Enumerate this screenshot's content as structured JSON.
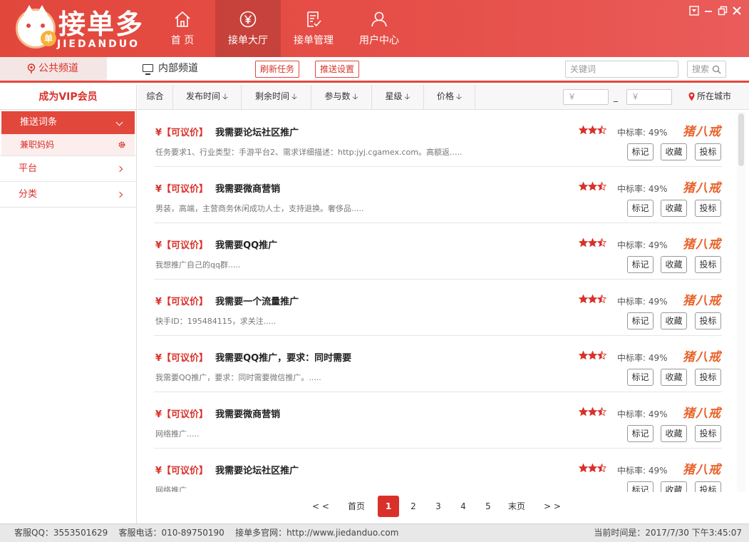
{
  "app": {
    "logo_cn": "接单多",
    "logo_en": "JIEDANDUO",
    "logo_coin": "单"
  },
  "nav": [
    {
      "label": "首 页",
      "icon": "home-icon"
    },
    {
      "label": "接单大厅",
      "icon": "yen-icon",
      "active": true
    },
    {
      "label": "接单管理",
      "icon": "document-icon"
    },
    {
      "label": "用户中心",
      "icon": "user-icon"
    }
  ],
  "channels": {
    "public": "公共频道",
    "private": "内部频道",
    "refresh": "刷新任务",
    "push_settings": "推送设置",
    "search_placeholder": "关键词",
    "search_button": "搜索"
  },
  "sidebar": {
    "vip": "成为VIP会员",
    "section": "推送词条",
    "sub_item": "兼职妈妈",
    "items": [
      "平台",
      "分类"
    ]
  },
  "filters": {
    "items": [
      "综合",
      "发布时间",
      "剩余时间",
      "参与数",
      "星级",
      "价格"
    ],
    "price_min_placeholder": "￥",
    "price_max_placeholder": "￥",
    "dash": "_",
    "city": "所在城市"
  },
  "tasks": [
    {
      "yen": "¥",
      "tag": "【可议价】",
      "title": "我需要论坛社区推广",
      "desc": "任务要求1、行业类型：手游平台2、需求详细描述：http:jyj.cgamex.com。高额返.....",
      "rate": "中标率: 49%",
      "brand": "猪八戒"
    },
    {
      "yen": "¥",
      "tag": "【可议价】",
      "title": "我需要微商营销",
      "desc": "男装，高端，主营商务休闲成功人士，支持退换。奢侈品.....",
      "rate": "中标率: 49%",
      "brand": "猪八戒"
    },
    {
      "yen": "¥",
      "tag": "【可议价】",
      "title": "我需要QQ推广",
      "desc": "我想推广自己的qq群.....",
      "rate": "中标率: 49%",
      "brand": "猪八戒"
    },
    {
      "yen": "¥",
      "tag": "【可议价】",
      "title": "我需要一个流量推广",
      "desc": "快手ID：195484115，求关注.....",
      "rate": "中标率: 49%",
      "brand": "猪八戒"
    },
    {
      "yen": "¥",
      "tag": "【可议价】",
      "title": "我需要QQ推广，要求：同时需要",
      "desc": "我需要QQ推广，要求：同时需要微信推广。.....",
      "rate": "中标率: 49%",
      "brand": "猪八戒"
    },
    {
      "yen": "¥",
      "tag": "【可议价】",
      "title": "我需要微商营销",
      "desc": "网络推广.....",
      "rate": "中标率: 49%",
      "brand": "猪八戒"
    },
    {
      "yen": "¥",
      "tag": "【可议价】",
      "title": "我需要论坛社区推广",
      "desc": "网络推广",
      "rate": "中标率: 49%",
      "brand": "猪八戒"
    }
  ],
  "task_rating": 2.5,
  "task_actions": {
    "mark": "标记",
    "favorite": "收藏",
    "bid": "投标"
  },
  "pagination": {
    "prev": "< <",
    "first": "首页",
    "pages": [
      "1",
      "2",
      "3",
      "4",
      "5"
    ],
    "current": "1",
    "last": "末页",
    "next": "> >"
  },
  "status": {
    "left": "客服QQ：3553501629    客服电话：010-89750190    接单多官网：http://www.jiedanduo.com",
    "right": "当前时间是：2017/7/30 下午3:45:07"
  },
  "colors": {
    "brand": "#e2473c",
    "accent_text": "#d9312a",
    "partner_brand": "#e8632a"
  }
}
